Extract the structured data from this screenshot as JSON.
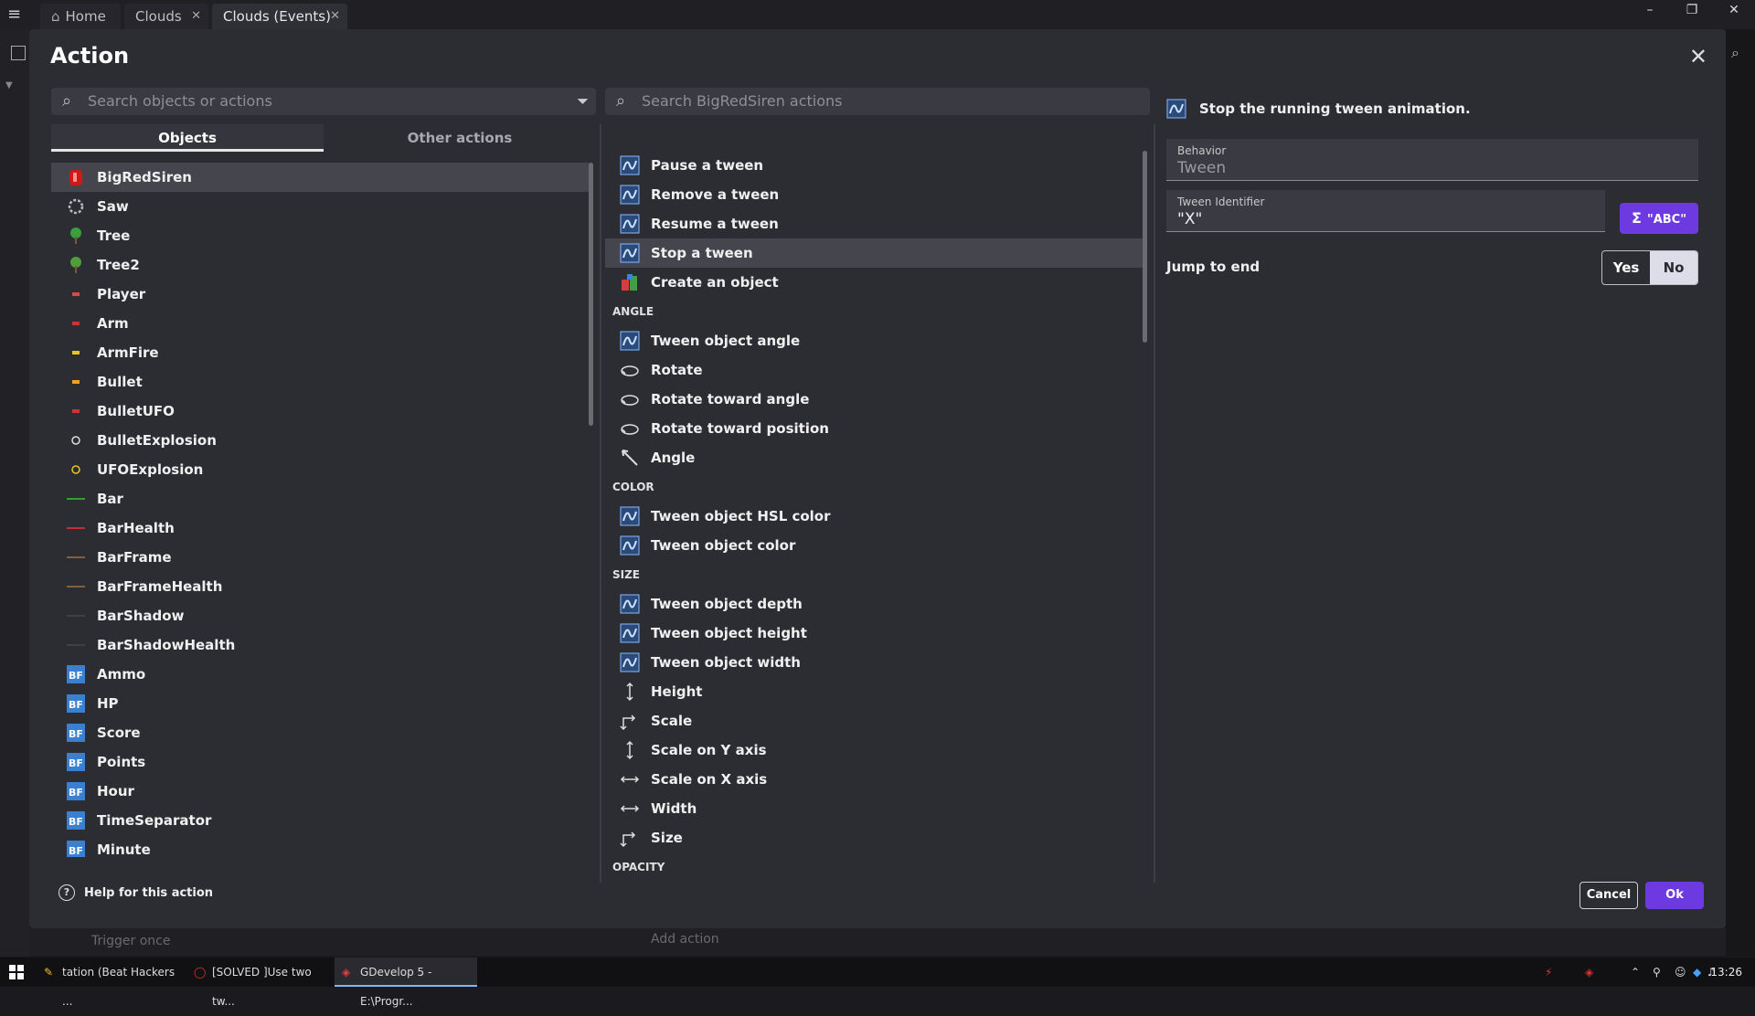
{
  "window": {
    "tabs": [
      {
        "label": "Home"
      },
      {
        "label": "Clouds"
      },
      {
        "label": "Clouds (Events)"
      }
    ],
    "controls": [
      "minimize",
      "restore",
      "close"
    ]
  },
  "dialog": {
    "title": "Action",
    "left_search_placeholder": "Search objects or actions",
    "left_tabs": [
      "Objects",
      "Other actions"
    ],
    "objects": [
      {
        "name": "BigRedSiren",
        "icon": "siren-icon",
        "color": "#d01818",
        "selected": true
      },
      {
        "name": "Saw",
        "icon": "saw-icon",
        "color": "#bbbbbb"
      },
      {
        "name": "Tree",
        "icon": "tree-icon",
        "color": "#3aa03a"
      },
      {
        "name": "Tree2",
        "icon": "tree-icon",
        "color": "#4e9e3a"
      },
      {
        "name": "Player",
        "icon": "player-icon",
        "color": "#d05040"
      },
      {
        "name": "Arm",
        "icon": "arm-icon",
        "color": "#cc3333"
      },
      {
        "name": "ArmFire",
        "icon": "fire-icon",
        "color": "#f0c020"
      },
      {
        "name": "Bullet",
        "icon": "bullet-icon",
        "color": "#f0a020"
      },
      {
        "name": "BulletUFO",
        "icon": "bullet-ufo-icon",
        "color": "#cc3333"
      },
      {
        "name": "BulletExplosion",
        "icon": "explosion-icon",
        "color": "#dddddd"
      },
      {
        "name": "UFOExplosion",
        "icon": "explosion-icon",
        "color": "#f0c020"
      },
      {
        "name": "Bar",
        "icon": "bar-icon",
        "color": "#30a030"
      },
      {
        "name": "BarHealth",
        "icon": "bar-icon",
        "color": "#c03030"
      },
      {
        "name": "BarFrame",
        "icon": "bar-icon",
        "color": "#806040"
      },
      {
        "name": "BarFrameHealth",
        "icon": "bar-icon",
        "color": "#806040"
      },
      {
        "name": "BarShadow",
        "icon": "bar-icon",
        "color": "#404040"
      },
      {
        "name": "BarShadowHealth",
        "icon": "bar-icon",
        "color": "#404040"
      },
      {
        "name": "Ammo",
        "icon": "bitmap-text-icon",
        "color": "#3a7fd0"
      },
      {
        "name": "HP",
        "icon": "bitmap-text-icon",
        "color": "#3a7fd0"
      },
      {
        "name": "Score",
        "icon": "bitmap-text-icon",
        "color": "#3a7fd0"
      },
      {
        "name": "Points",
        "icon": "bitmap-text-icon",
        "color": "#3a7fd0"
      },
      {
        "name": "Hour",
        "icon": "bitmap-text-icon",
        "color": "#3a7fd0"
      },
      {
        "name": "TimeSeparator",
        "icon": "bitmap-text-icon",
        "color": "#3a7fd0"
      },
      {
        "name": "Minute",
        "icon": "bitmap-text-icon",
        "color": "#3a7fd0"
      }
    ],
    "mid_search_placeholder": "Search BigRedSiren actions",
    "actions": [
      {
        "kind": "item",
        "label": "Pause a tween",
        "icon": "tween-icon"
      },
      {
        "kind": "item",
        "label": "Remove a tween",
        "icon": "tween-icon"
      },
      {
        "kind": "item",
        "label": "Resume a tween",
        "icon": "tween-icon"
      },
      {
        "kind": "item",
        "label": "Stop a tween",
        "icon": "tween-icon",
        "selected": true
      },
      {
        "kind": "item",
        "label": "Create an object",
        "icon": "create-object-icon"
      },
      {
        "kind": "head",
        "label": "ANGLE"
      },
      {
        "kind": "item",
        "label": "Tween object angle",
        "icon": "tween-icon"
      },
      {
        "kind": "item",
        "label": "Rotate",
        "icon": "rotate-icon"
      },
      {
        "kind": "item",
        "label": "Rotate toward angle",
        "icon": "rotate-icon"
      },
      {
        "kind": "item",
        "label": "Rotate toward position",
        "icon": "rotate-icon"
      },
      {
        "kind": "item",
        "label": "Angle",
        "icon": "angle-icon"
      },
      {
        "kind": "head",
        "label": "COLOR"
      },
      {
        "kind": "item",
        "label": "Tween object HSL color",
        "icon": "tween-icon"
      },
      {
        "kind": "item",
        "label": "Tween object color",
        "icon": "tween-icon"
      },
      {
        "kind": "head",
        "label": "SIZE"
      },
      {
        "kind": "item",
        "label": "Tween object depth",
        "icon": "tween-icon"
      },
      {
        "kind": "item",
        "label": "Tween object height",
        "icon": "tween-icon"
      },
      {
        "kind": "item",
        "label": "Tween object width",
        "icon": "tween-icon"
      },
      {
        "kind": "item",
        "label": "Height",
        "icon": "height-icon"
      },
      {
        "kind": "item",
        "label": "Scale",
        "icon": "scale-icon"
      },
      {
        "kind": "item",
        "label": "Scale on Y axis",
        "icon": "height-icon"
      },
      {
        "kind": "item",
        "label": "Scale on X axis",
        "icon": "width-icon"
      },
      {
        "kind": "item",
        "label": "Width",
        "icon": "width-icon"
      },
      {
        "kind": "item",
        "label": "Size",
        "icon": "scale-icon"
      },
      {
        "kind": "head",
        "label": "OPACITY"
      }
    ],
    "details": {
      "description": "Stop the running tween animation.",
      "behavior_label": "Behavior",
      "behavior_value": "Tween",
      "tween_id_label": "Tween Identifier",
      "tween_id_value": "\"X\"",
      "expr_button": "\"ABC\"",
      "jump_label": "Jump to end",
      "yes": "Yes",
      "no": "No",
      "selected": "No"
    },
    "help": "Help for this action",
    "cancel": "Cancel",
    "ok": "Ok"
  },
  "background": {
    "trigger": "Trigger once",
    "add_action": "Add action"
  },
  "taskbar": {
    "items": [
      {
        "label": "tation (Beat Hackers ..."
      },
      {
        "label": "[SOLVED ]Use two tw..."
      },
      {
        "label": "GDevelop 5 - E:\\Progr..."
      }
    ],
    "clock": "13:26"
  }
}
